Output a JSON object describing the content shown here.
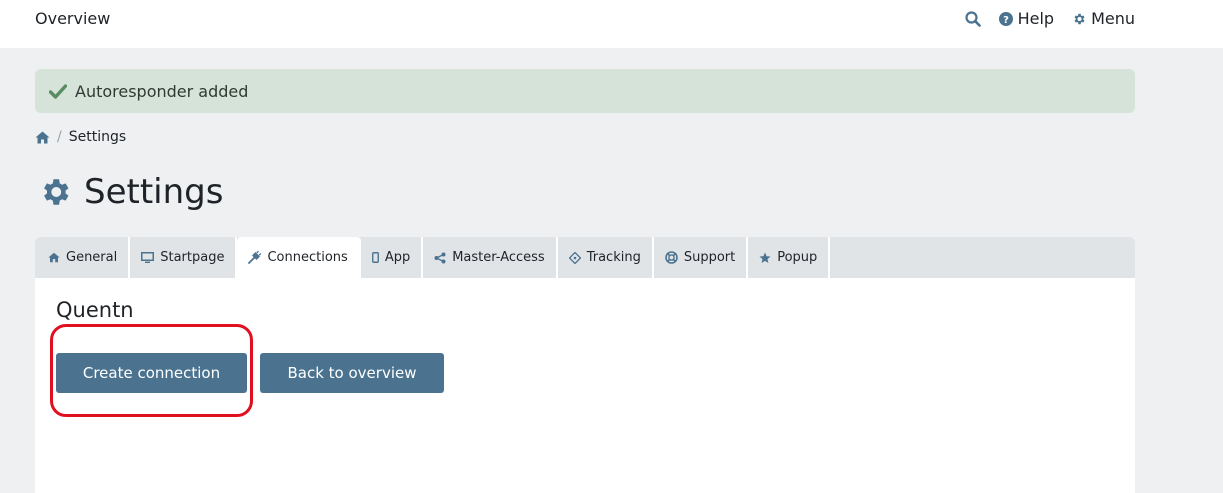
{
  "topbar": {
    "title": "Overview",
    "search_icon": "search-icon",
    "help_label": "Help",
    "menu_label": "Menu"
  },
  "alert": {
    "icon": "check-icon",
    "message": "Autoresponder added",
    "color": "#d6e3d8"
  },
  "breadcrumb": {
    "home_icon": "home-icon",
    "separator": "/",
    "current": "Settings"
  },
  "page": {
    "title": "Settings",
    "icon": "gear-icon"
  },
  "tabs": [
    {
      "label": "General",
      "icon": "home-icon",
      "active": false
    },
    {
      "label": "Startpage",
      "icon": "monitor-icon",
      "active": false
    },
    {
      "label": "Connections",
      "icon": "plug-icon",
      "active": true
    },
    {
      "label": "App",
      "icon": "mobile-icon",
      "active": false
    },
    {
      "label": "Master-Access",
      "icon": "share-icon",
      "active": false
    },
    {
      "label": "Tracking",
      "icon": "crosshair-icon",
      "active": false
    },
    {
      "label": "Support",
      "icon": "lifebuoy-icon",
      "active": false
    },
    {
      "label": "Popup",
      "icon": "star-icon",
      "active": false
    }
  ],
  "content": {
    "section_title": "Quentn",
    "create_button": "Create connection",
    "back_button": "Back to overview"
  },
  "colors": {
    "accent": "#4b7390",
    "highlight": "#e0101f",
    "background": "#eef0f2"
  }
}
